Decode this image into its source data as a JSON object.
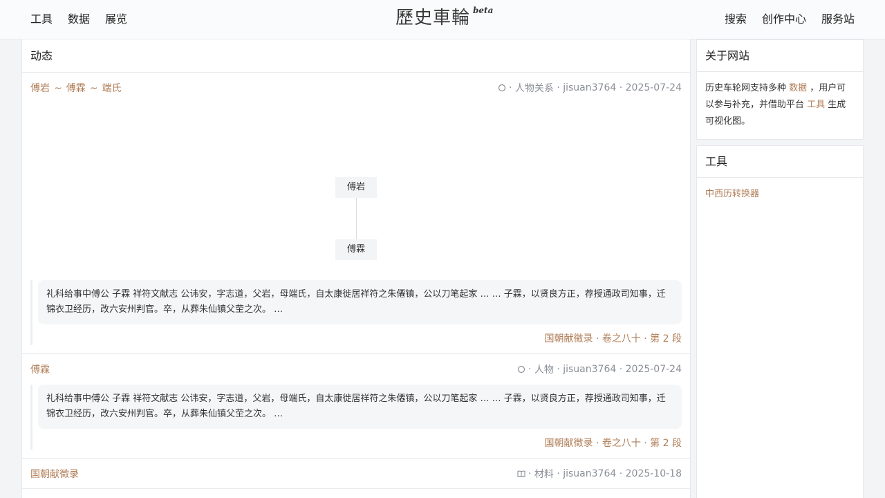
{
  "nav": {
    "left": [
      "工具",
      "数据",
      "展览"
    ],
    "brand": "歷史車輪",
    "beta": "beta",
    "right": [
      "搜索",
      "创作中心",
      "服务站"
    ]
  },
  "feed": {
    "header": "动态",
    "entries": [
      {
        "title_parts": [
          "傅岩",
          "~",
          "傅霖",
          "~",
          "端氏"
        ],
        "type": "人物关系",
        "user": "jisuan3764",
        "date": "2025-07-24",
        "icon": "circle-icon",
        "graph_nodes": [
          "傅岩",
          "傅霖"
        ],
        "quote": "礼科给事中傅公 子霖 祥符文献志 公讳安，字志道，父岩，母端氏，自太康徙居祥符之朱僊镇，公以刀笔起家 … … 子霖，以贤良方正，荐授通政司知事，迁锦衣卫经历，改六安州判官。卒，从葬朱仙镇父茔之次。 …",
        "source": "国朝献徵录 · 卷之八十 · 第 2 段"
      },
      {
        "title": "傅霖",
        "type": "人物",
        "user": "jisuan3764",
        "date": "2025-07-24",
        "icon": "circle-icon",
        "quote": "礼科给事中傅公 子霖 祥符文献志 公讳安，字志道，父岩，母端氏，自太康徙居祥符之朱僊镇，公以刀笔起家 … … 子霖，以贤良方正，荐授通政司知事，迁锦衣卫经历，改六安州判官。卒，从葬朱仙镇父茔之次。 …",
        "source": "国朝献徵录 · 卷之八十 · 第 2 段"
      },
      {
        "title": "国朝献徵录",
        "type": "材料",
        "user": "jisuan3764",
        "date": "2025-10-18",
        "icon": "book-icon"
      }
    ]
  },
  "sidebar": {
    "about": {
      "title": "关于网站",
      "text_a": "历史车轮网支持多种 ",
      "link_data": "数据",
      "text_b": " ，用户可以参与补充，并借助平台 ",
      "link_tool": "工具",
      "text_c": " 生成可视化图。"
    },
    "tools": {
      "title": "工具",
      "items": [
        "中西历转换器"
      ]
    }
  },
  "colors": {
    "accent": "#b07d57",
    "muted": "#8a8f96",
    "border": "#e6e8eb"
  }
}
